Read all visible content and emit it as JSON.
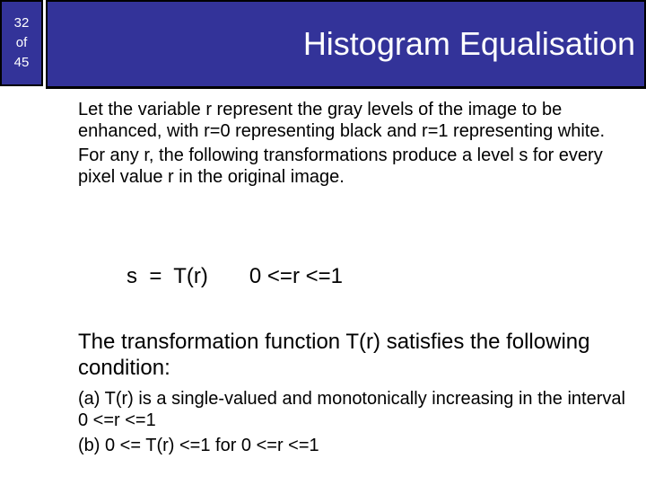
{
  "slide_counter": {
    "current": "32",
    "separator": "of",
    "total": "45"
  },
  "header": {
    "title": "Histogram Equalisation"
  },
  "colors": {
    "header_bg": "#333399",
    "header_border": "#000000",
    "header_text": "#ffffff",
    "body_text": "#000000",
    "page_bg": "#ffffff"
  },
  "content": {
    "intro_paragraphs": [
      "Let the variable r represent the gray levels of the image to be enhanced, with r=0 representing black and r=1 representing white.",
      "For any r, the following transformations produce a level s for every pixel value r in the original image."
    ],
    "formula": {
      "lhs": "s  =  T(r)",
      "rhs": "0 <=r <=1"
    },
    "condition_intro": "The transformation function T(r) satisfies the following condition:",
    "conditions": [
      "(a) T(r) is a single-valued and monotonically increasing in the interval 0 <=r <=1",
      "(b) 0 <= T(r) <=1 for 0 <=r <=1"
    ]
  }
}
